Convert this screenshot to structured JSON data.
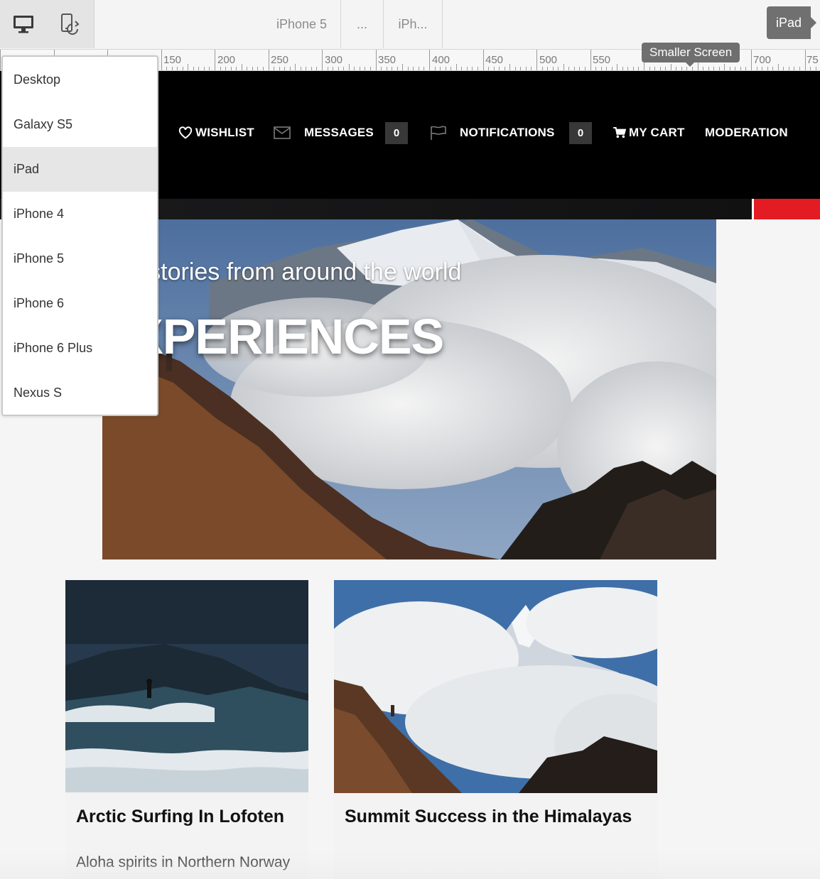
{
  "toolbar": {
    "desktop_icon": "desktop-icon",
    "rotate_icon": "rotate-device-icon",
    "devices": [
      "iPhone 5",
      "...",
      "iPh..."
    ],
    "current_device": "iPad"
  },
  "ruler": {
    "labels": [
      "150",
      "200",
      "250",
      "300",
      "350",
      "400",
      "450",
      "500",
      "550",
      "700",
      "75"
    ]
  },
  "tooltip": "Smaller Screen",
  "nav": {
    "wishlist": "WISHLIST",
    "messages": "MESSAGES",
    "messages_count": "0",
    "notifications": "NOTIFICATIONS",
    "notifications_count": "0",
    "cart": "MY CART",
    "moderation": "MODERATION"
  },
  "hero": {
    "tagline": "ring stories from around the world",
    "title": "XPERIENCES"
  },
  "cards": [
    {
      "title": "Arctic Surfing In Lofoten",
      "subtitle": "Aloha spirits in Northern Norway"
    },
    {
      "title": "Summit Success in the Himalayas"
    }
  ],
  "device_menu": {
    "items": [
      "Desktop",
      "Galaxy S5",
      "iPad",
      "iPhone 4",
      "iPhone 5",
      "iPhone 6",
      "iPhone 6 Plus",
      "Nexus S"
    ],
    "selected": "iPad"
  },
  "colors": {
    "accent_red": "#e31b23",
    "nav_bg": "#000000",
    "count_bg": "#383838"
  }
}
